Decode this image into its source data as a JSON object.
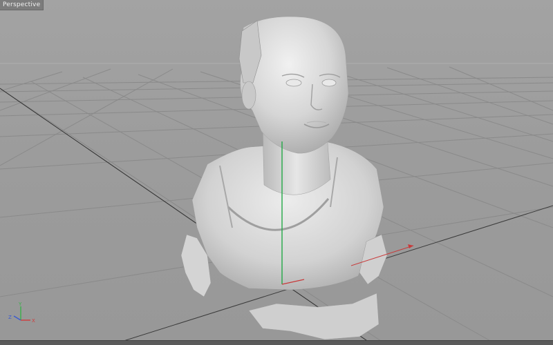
{
  "viewport": {
    "label": "Perspective",
    "projection": "perspective"
  },
  "axis_gizmo": {
    "x_label": "X",
    "y_label": "Y",
    "z_label": "Z",
    "x_color": "#d03a3a",
    "y_color": "#3ab04a",
    "z_color": "#3a5ad0"
  },
  "scene": {
    "model": "scanned-bust",
    "model_color": "#d9d9d9",
    "grid_color": "#8a8a8a",
    "world_axis_x_color": "#c83a3a",
    "world_axis_y_color": "#22a845"
  }
}
